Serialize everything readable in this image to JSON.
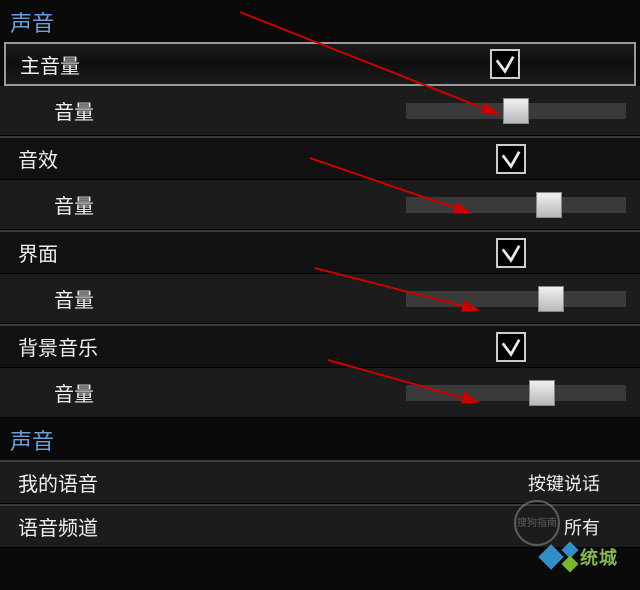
{
  "sections": {
    "sound1": {
      "title": "声音"
    },
    "sound2": {
      "title": "声音"
    }
  },
  "groups": [
    {
      "label": "主音量",
      "checked": true,
      "slider_label": "音量",
      "slider_value": 50
    },
    {
      "label": "音效",
      "checked": true,
      "slider_label": "音量",
      "slider_value": 65
    },
    {
      "label": "界面",
      "checked": true,
      "slider_label": "音量",
      "slider_value": 66
    },
    {
      "label": "背景音乐",
      "checked": true,
      "slider_label": "音量",
      "slider_value": 62
    }
  ],
  "voice": {
    "my_voice_label": "我的语音",
    "my_voice_value": "按键说话",
    "channel_label": "语音频道",
    "channel_value": "所有"
  },
  "watermark": {
    "brand": "统城",
    "circle": "搜狗指南"
  }
}
